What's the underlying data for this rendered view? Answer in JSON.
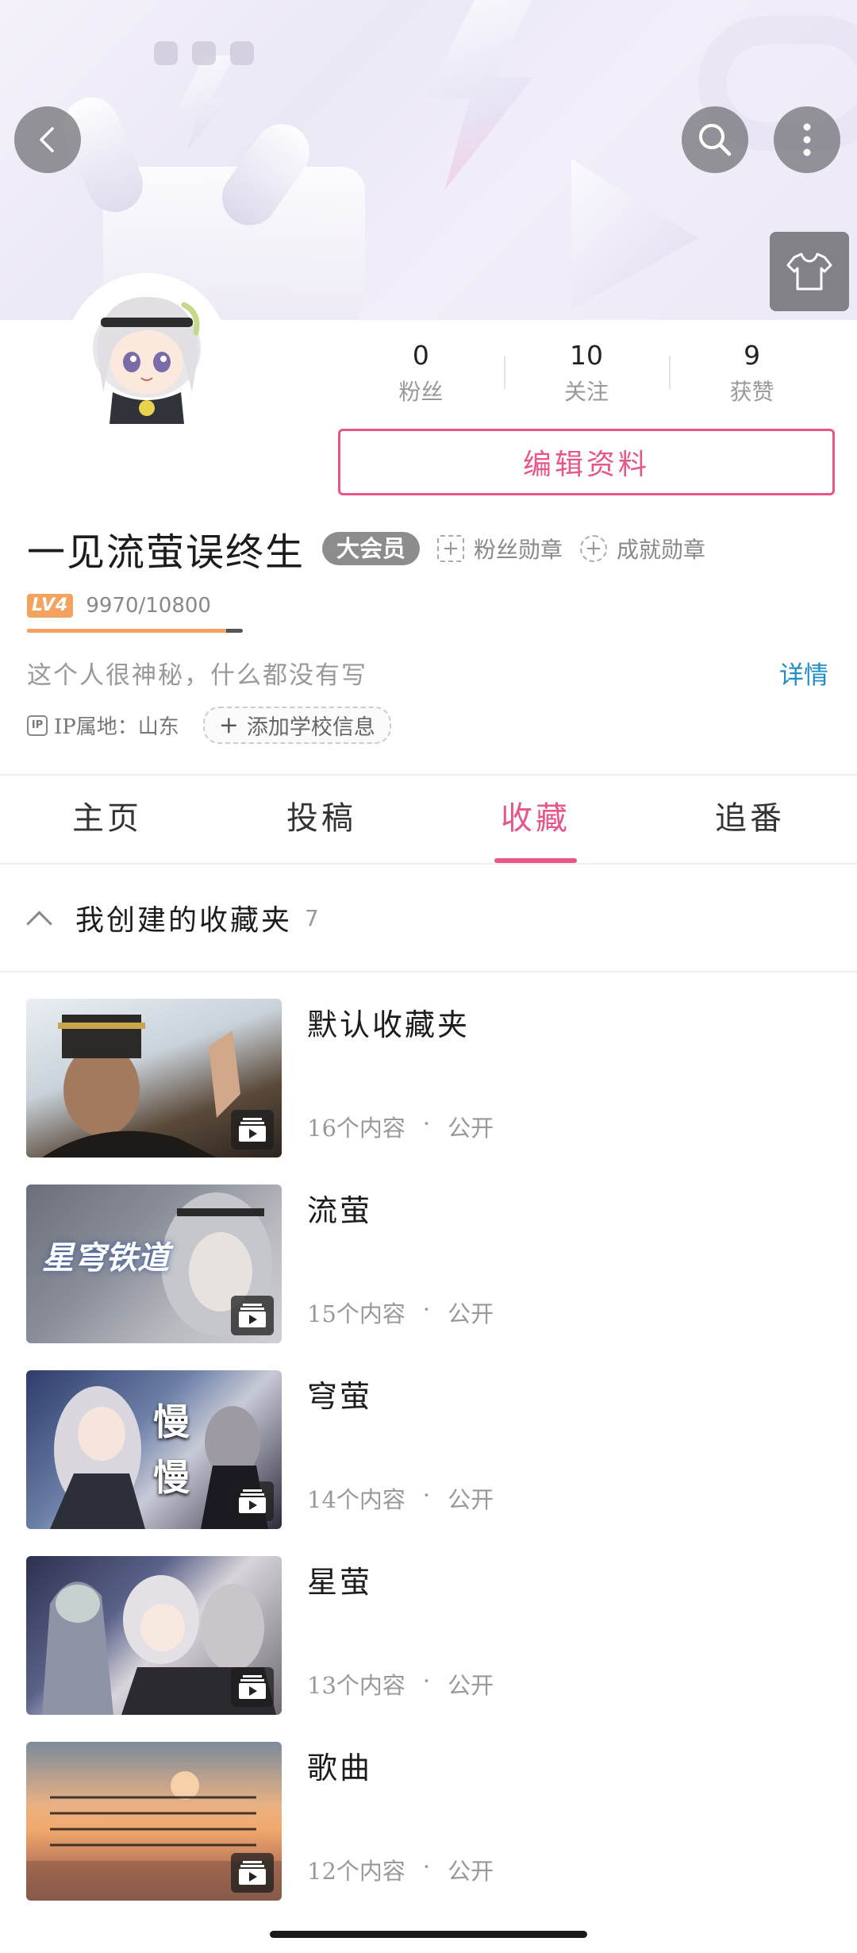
{
  "header": {
    "back_icon": "chevron-left-icon",
    "search_icon": "search-icon",
    "more_icon": "more-vertical-icon",
    "dress_icon": "shirt-icon"
  },
  "profile": {
    "stats": [
      {
        "value": "0",
        "label": "粉丝"
      },
      {
        "value": "10",
        "label": "关注"
      },
      {
        "value": "9",
        "label": "获赞"
      }
    ],
    "edit_label": "编辑资料",
    "username": "一见流萤误终生",
    "vip_label": "大会员",
    "fan_medal_label": "粉丝勋章",
    "achievement_medal_label": "成就勋章",
    "level_label": "LV4",
    "exp_text": "9970/10800",
    "exp_fraction": 0.923,
    "bio": "这个人很神秘，什么都没有写",
    "detail_link": "详情",
    "ip_icon_text": "IP",
    "ip_text": "IP属地：山东",
    "school_label": "添加学校信息"
  },
  "tabs": [
    {
      "label": "主页",
      "active": false
    },
    {
      "label": "投稿",
      "active": false
    },
    {
      "label": "收藏",
      "active": true
    },
    {
      "label": "追番",
      "active": false
    }
  ],
  "folders_section": {
    "title": "我创建的收藏夹",
    "count": "7"
  },
  "folders": [
    {
      "title": "默认收藏夹",
      "count": "16个内容",
      "visibility": "公开"
    },
    {
      "title": "流萤",
      "count": "15个内容",
      "visibility": "公开",
      "thumb_text": "星穹铁道"
    },
    {
      "title": "穹萤",
      "count": "14个内容",
      "visibility": "公开",
      "thumb_text": "慢慢"
    },
    {
      "title": "星萤",
      "count": "13个内容",
      "visibility": "公开"
    },
    {
      "title": "歌曲",
      "count": "12个内容",
      "visibility": "公开"
    }
  ],
  "colors": {
    "accent": "#e7558b",
    "link": "#1e8cc5",
    "level": "#f3a35f"
  }
}
